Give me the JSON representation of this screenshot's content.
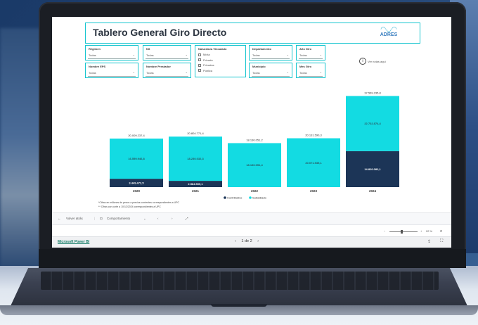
{
  "report": {
    "title": "Tablero General Giro Directo",
    "logo_text": "ADRES",
    "info_text": "Ver notas aquí"
  },
  "filters": [
    {
      "label": "Régimen",
      "value": "Todas"
    },
    {
      "label": "Nit",
      "value": "Todas"
    },
    {
      "label": "Naturaleza Vinculado",
      "options": [
        "Mixta",
        "Privada",
        "Privadas",
        "Pública"
      ]
    },
    {
      "label": "Departamento",
      "value": "Todas"
    },
    {
      "label": "Año Giro",
      "value": "Todas"
    },
    {
      "label": "Nombre EPS",
      "value": "Todas"
    },
    {
      "label": "Nombre Prestador",
      "value": "Todas"
    },
    {
      "label": "Municipio",
      "value": "Todas"
    },
    {
      "label": "Mes Giro",
      "value": "Todas"
    }
  ],
  "chart_data": {
    "type": "bar",
    "stacked": true,
    "categories": [
      "2020",
      "2021",
      "2022",
      "2023",
      "2024"
    ],
    "series": [
      {
        "name": "Contributivo",
        "color": "#1c3557",
        "values": [
          3449.4,
          2584.5,
          0,
          0,
          14820.1
        ],
        "labels": [
          "3.449.472,5",
          "2.584.509,1",
          "",
          "",
          "14.820.082,1"
        ]
      },
      {
        "name": "Subsidiado",
        "color": "#13dbe2",
        "values": [
          16559.0,
          18230.3,
          18130.2,
          20131.6,
          22732.6
        ],
        "labels": [
          "16.559.946,8",
          "18.230.032,3",
          "18.130.051,4",
          "20.071.935,1",
          "22.732.874,4"
        ]
      }
    ],
    "totals": [
      "20.009.237,4",
      "20.804.771,4",
      "18.130.051,2",
      "20.131.590,3",
      "37.569.235,8"
    ],
    "ylim": [
      0,
      40000
    ],
    "legend_position": "bottom-center"
  },
  "footnotes": [
    "*Cifras en millones de pesos a precios corrientes correspondientes a UPC",
    "** Cifras con corte a 10/12/2024 correspondientes a UPC"
  ],
  "bottom_nav": {
    "back": "Volver atrás",
    "page": "Comportamiento"
  },
  "zoom": {
    "value": "92 %"
  },
  "status": {
    "brand_link": "Microsoft Power BI",
    "pager": "1 de 2"
  }
}
